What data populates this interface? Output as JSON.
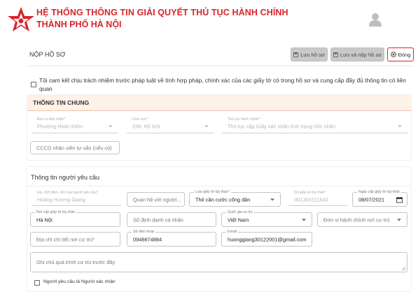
{
  "header": {
    "title_line1": "HỆ THỐNG THÔNG TIN GIẢI QUYẾT THỦ TỤC HÀNH CHÍNH",
    "title_line2": "THÀNH PHỐ HÀ NỘI",
    "brand_color": "#d6262b",
    "logo_icon": "red-star-logo-icon",
    "avatar_icon": "user-avatar-icon"
  },
  "toolbar": {
    "title": "NỘP HỒ SƠ",
    "save_label": "Lưu hồ sơ",
    "save_submit_label": "Lưu và nộp hồ sơ",
    "close_label": "Đóng"
  },
  "commitment": {
    "text": "Tôi cam kết chịu trách nhiệm trước pháp luật về tính hợp pháp, chính xác của các giấy tờ có trong hồ sơ và cung cấp đầy đủ thông tin có liên quan",
    "checked": false
  },
  "general_info": {
    "title": "THÔNG TIN CHUNG",
    "reception_unit": {
      "label": "Đơn vị tiếp nhận*",
      "value": "Phường Hoàn Kiếm"
    },
    "field": {
      "label": "Lĩnh vực*",
      "value": "236: Hộ tịch"
    },
    "procedure": {
      "label": "Thủ tục hành chính*",
      "value": "Thủ tục cấp Giấy xác nhận tình trạng hôn nhân"
    },
    "officer_cccd": {
      "placeholder": "CCCD nhân viên tư vấn (nếu có)"
    }
  },
  "requester": {
    "title": "Thông tin người yêu cầu",
    "full_name": {
      "label": "Họ, chữ đệm, tên của người yêu cầu*",
      "value": "Hoàng Hương Giang"
    },
    "relation": {
      "placeholder": "Quan hệ với người..."
    },
    "id_type": {
      "label": "Loại giấy tờ tùy thân*",
      "value": "Thẻ căn cước công dân"
    },
    "id_number": {
      "label": "Số giấy tờ tùy thân*",
      "value": "001301011543"
    },
    "issue_date": {
      "label": "Ngày cấp giấy tờ tùy thân",
      "value": "08/07/2021"
    },
    "issue_place": {
      "label": "Nơi cấp giấy tờ tùy thân",
      "value": "Hà Nội"
    },
    "personal_id": {
      "placeholder": "Số định danh cá nhân"
    },
    "residence_country": {
      "label": "Quốc gia cư trú",
      "value": "Việt Nam"
    },
    "admin_unit": {
      "placeholder": "Đơn vị hành chính nơi cư trú"
    },
    "address_detail": {
      "placeholder": "Địa chỉ chi tiết nơi cư trú*"
    },
    "phone": {
      "label": "Số điện thoại",
      "value": "0946674884"
    },
    "email": {
      "label": "Email",
      "value": "huonggiang30122001@gmail.com"
    },
    "notes": {
      "placeholder": "Ghi chú quá trình cư trú trước đây"
    },
    "is_witness": {
      "label": "Người yêu cầu là Người xác nhận",
      "checked": false
    }
  }
}
